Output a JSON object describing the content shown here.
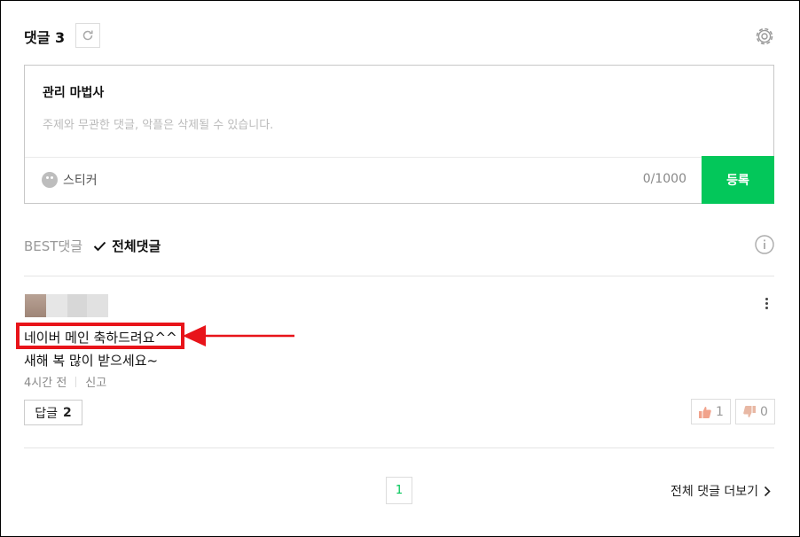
{
  "header": {
    "title": "댓글 3"
  },
  "editor": {
    "user_name": "관리 마법사",
    "placeholder": "주제와 무관한 댓글, 악플은 삭제될 수 있습니다.",
    "sticker_label": "스티커",
    "counter": "0/1000",
    "submit_label": "등록"
  },
  "tabs": {
    "best": "BEST댓글",
    "all": "전체댓글"
  },
  "comment": {
    "line1": "네이버 메인 축하드려요^^",
    "line2": "새해 복 많이 받으세요~",
    "time": "4시간 전",
    "report": "신고",
    "reply_label": "답글",
    "reply_count": "2",
    "likes": "1",
    "dislikes": "0"
  },
  "pagination": {
    "current": "1"
  },
  "footer": {
    "more_label": "전체 댓글 더보기"
  },
  "colors": {
    "accent": "#03c75a",
    "highlight": "#e8141a"
  },
  "icons": [
    "refresh-icon",
    "gear-icon",
    "sticker-icon",
    "check-icon",
    "info-icon",
    "more-vertical-icon",
    "thumbs-up-icon",
    "thumbs-down-icon",
    "chevron-right-icon",
    "arrow-icon"
  ]
}
